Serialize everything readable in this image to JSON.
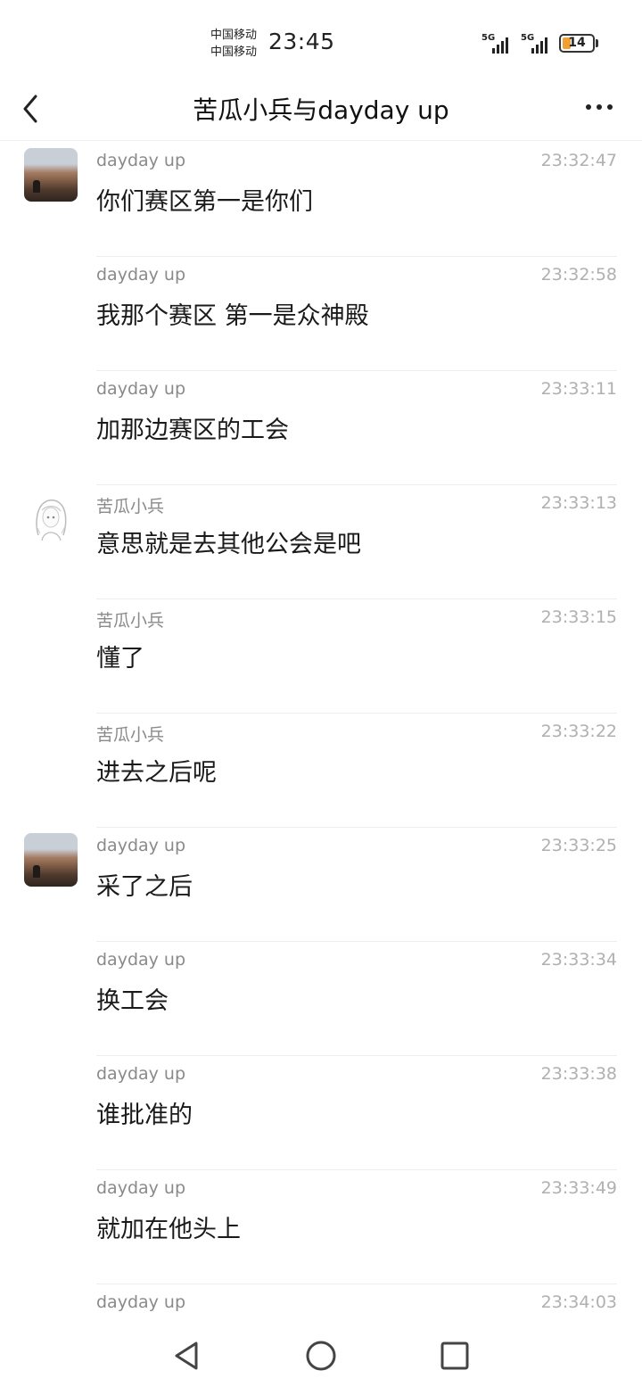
{
  "status_bar": {
    "carrier_1": "中国移动",
    "carrier_2": "中国移动",
    "time": "23:45",
    "signal_1_label": "5G",
    "signal_2_label": "5G",
    "battery_level": "14"
  },
  "header": {
    "title": "苦瓜小兵与dayday up",
    "back_icon": "chevron-left-icon",
    "more_icon": "more-horizontal-icon"
  },
  "messages": [
    {
      "sender": "dayday up",
      "time": "23:32:47",
      "text": "你们赛区第一是你们",
      "avatar": "landscape"
    },
    {
      "sender": "dayday up",
      "time": "23:32:58",
      "text": "我那个赛区 第一是众神殿",
      "avatar": ""
    },
    {
      "sender": "dayday up",
      "time": "23:33:11",
      "text": "加那边赛区的工会",
      "avatar": ""
    },
    {
      "sender": "苦瓜小兵",
      "time": "23:33:13",
      "text": "意思就是去其他公会是吧",
      "avatar": "girl"
    },
    {
      "sender": "苦瓜小兵",
      "time": "23:33:15",
      "text": "懂了",
      "avatar": ""
    },
    {
      "sender": "苦瓜小兵",
      "time": "23:33:22",
      "text": "进去之后呢",
      "avatar": ""
    },
    {
      "sender": "dayday up",
      "time": "23:33:25",
      "text": "采了之后",
      "avatar": "landscape"
    },
    {
      "sender": "dayday up",
      "time": "23:33:34",
      "text": "换工会",
      "avatar": ""
    },
    {
      "sender": "dayday up",
      "time": "23:33:38",
      "text": "谁批准的",
      "avatar": ""
    },
    {
      "sender": "dayday up",
      "time": "23:33:49",
      "text": "就加在他头上",
      "avatar": ""
    },
    {
      "sender": "dayday up",
      "time": "23:34:03",
      "text": "",
      "avatar": ""
    }
  ],
  "navbar": {
    "back_icon": "triangle-back-icon",
    "home_icon": "circle-home-icon",
    "recents_icon": "square-recents-icon"
  },
  "colors": {
    "battery_accent": "#f2a033",
    "sender_text": "#8a8a8a",
    "time_text": "#b0b0b0"
  }
}
